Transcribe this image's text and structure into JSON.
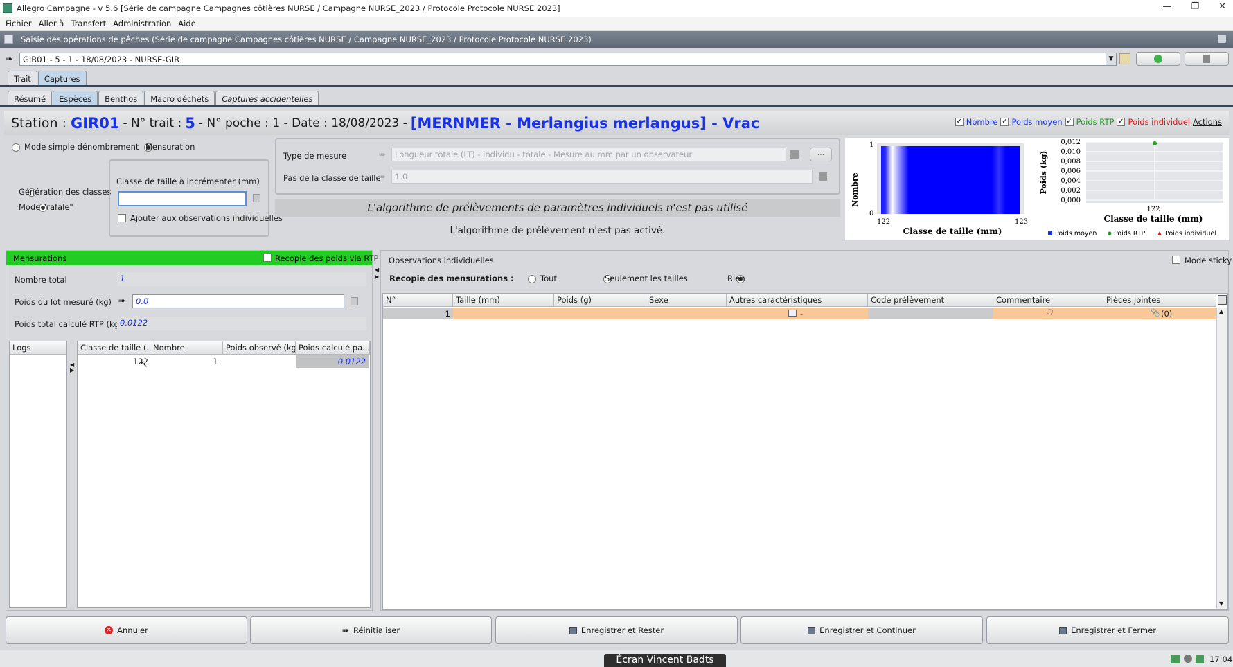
{
  "window": {
    "title": "Allegro Campagne - v 5.6 [Série de campagne Campagnes côtières NURSE / Campagne NURSE_2023 / Protocole Protocole NURSE 2023]"
  },
  "menu": [
    "Fichier",
    "Aller à",
    "Transfert",
    "Administration",
    "Aide"
  ],
  "section_title": "Saisie des opérations de pêches (Série de campagne Campagnes côtières NURSE / Campagne NURSE_2023 / Protocole Protocole NURSE 2023)",
  "operation": {
    "value": "GIR01 - 5 - 1 - 18/08/2023 - NURSE-GIR"
  },
  "tabs_main": [
    "Trait",
    "Captures"
  ],
  "tabs_sub": [
    "Résumé",
    "Espèces",
    "Benthos",
    "Macro déchets",
    "Captures accidentelles"
  ],
  "header": {
    "station_label": "Station :",
    "station": "GIR01",
    "trait_label": "- N° trait :",
    "trait": "5",
    "poche_label": "- N° poche : 1 - Date : 18/08/2023 -",
    "species": "[MERNMER - Merlangius merlangus] - Vrac"
  },
  "header_opts": {
    "nombre": "Nombre",
    "poids_moyen": "Poids moyen",
    "poids_rtp": "Poids RTP",
    "poids_individuel": "Poids individuel",
    "actions": "Actions"
  },
  "colors": {
    "nombre": "#1932e6",
    "poids_moyen": "#1932e6",
    "poids_rtp": "#1aa01a",
    "poids_individuel": "#e01818"
  },
  "mode": {
    "simple": "Mode simple dénombrement",
    "mensuration": "Mensuration",
    "generation": "Génération des classes",
    "rafale": "Mode \"rafale\""
  },
  "classe_box": {
    "title": "Classe de taille à incrémenter (mm)",
    "value": "",
    "ajouter": "Ajouter aux observations individuelles"
  },
  "mesure": {
    "type_label": "Type de mesure",
    "type_value": "Longueur totale (LT) - individu - totale - Mesure au mm par un observateur",
    "pas_label": "Pas de la classe de taille",
    "pas_value": "1.0"
  },
  "algo": {
    "banner": "L'algorithme de prélèvements de paramètres individuels n'est pas utilisé",
    "msg": "L'algorithme de prélèvement n'est pas activé."
  },
  "chart_data": [
    {
      "type": "bar",
      "categories": [
        "122"
      ],
      "values": [
        1
      ],
      "xlabel": "Classe de taille (mm)",
      "ylabel": "Nombre",
      "ylim": [
        0,
        1
      ],
      "x_ticks": [
        "122",
        "123"
      ],
      "y_ticks": [
        "0",
        "1"
      ]
    },
    {
      "type": "scatter",
      "series": [
        {
          "name": "Poids RTP",
          "x": [
            122
          ],
          "y": [
            0.0122
          ]
        }
      ],
      "xlabel": "Classe de taille (mm)",
      "ylabel": "Poids (kg)",
      "x_ticks": [
        "122"
      ],
      "y_ticks": [
        "0,012",
        "0,010",
        "0,008",
        "0,006",
        "0,004",
        "0,002",
        "0,000"
      ],
      "legend": [
        "Poids moyen",
        "Poids RTP",
        "Poids individuel"
      ]
    }
  ],
  "mensurations": {
    "title": "Mensurations",
    "recopie": "Recopie des poids via RTP",
    "nombre_total_label": "Nombre total",
    "nombre_total": "1",
    "poids_lot_label": "Poids du lot mesuré (kg)",
    "poids_lot": "0.0",
    "poids_rtp_label": "Poids total calculé RTP (kg)",
    "poids_rtp": "0.0122",
    "logs": "Logs",
    "columns": [
      "Classe de taille (...",
      "Nombre",
      "Poids observé (kg)",
      "Poids calculé pa..."
    ],
    "rows": [
      {
        "classe": "122",
        "nombre": "1",
        "poids_obs": "",
        "poids_calc": "0.0122"
      }
    ]
  },
  "observations": {
    "title": "Observations individuelles",
    "mode_sticky": "Mode sticky",
    "recopie_label": "Recopie des mensurations :",
    "opt_tout": "Tout",
    "opt_tailles": "Seulement les tailles",
    "opt_rien": "Rien",
    "columns": [
      "N°",
      "Taille (mm)",
      "Poids (g)",
      "Sexe",
      "Autres caractéristiques",
      "Code prélèvement",
      "Commentaire",
      "Pièces jointes"
    ],
    "rows": [
      {
        "n": "1",
        "autres": "-",
        "pieces": "(0)"
      }
    ]
  },
  "footer": {
    "annuler": "Annuler",
    "reinit": "Réinitialiser",
    "rester": "Enregistrer et Rester",
    "continuer": "Enregistrer et Continuer",
    "fermer": "Enregistrer et Fermer"
  },
  "status": {
    "ecran": "Écran Vincent Badts",
    "time": "17:04"
  }
}
